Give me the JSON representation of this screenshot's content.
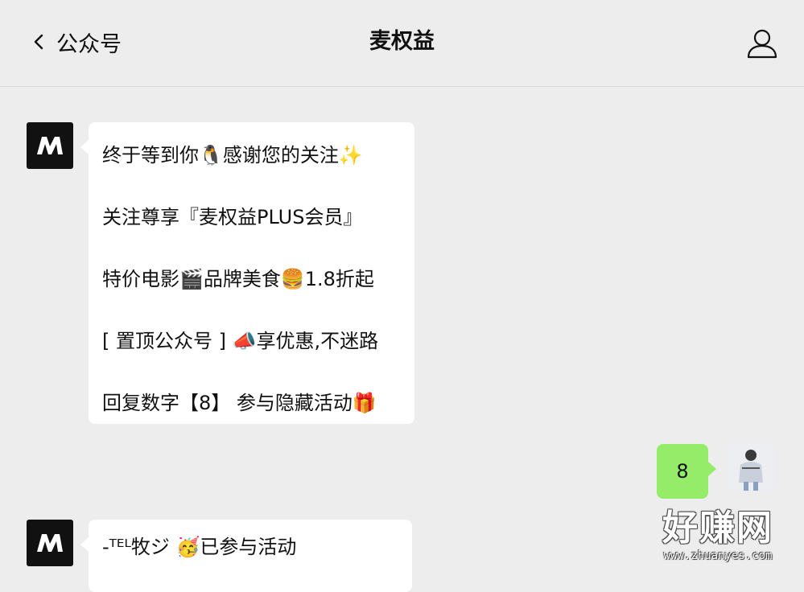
{
  "header": {
    "back_label": "公众号",
    "title": "麦权益"
  },
  "messages": [
    {
      "direction": "incoming",
      "lines": [
        "终于等到你🐧感谢您的关注✨",
        "关注尊享『麦权益PLUS会员』",
        "特价电影🎬品牌美食🍔1.8折起",
        "[ 置顶公众号 ] 📣享优惠,不迷路",
        "回复数字【8】 参与隐藏活动🎁"
      ]
    },
    {
      "direction": "outgoing",
      "text": "8"
    },
    {
      "direction": "incoming",
      "lines": [
        "-ᵀᴱᴸ牧ジ 🥳已参与活动"
      ]
    }
  ],
  "watermark": {
    "big": "好赚网",
    "small": "www.zhuanyes.com"
  },
  "colors": {
    "background": "#ededed",
    "outgoing_bubble": "#95ec69",
    "incoming_bubble": "#ffffff",
    "brand_avatar": "#111111"
  },
  "icons": [
    "back-chevron-icon",
    "profile-icon",
    "brand-logo-icon"
  ]
}
